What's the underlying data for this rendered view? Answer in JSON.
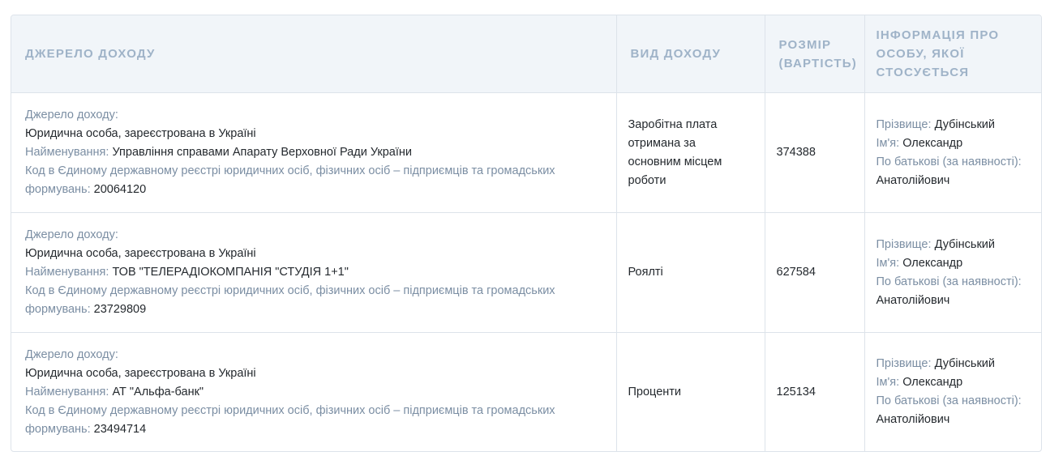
{
  "table": {
    "headers": {
      "source": "Джерело доходу",
      "type": "Вид доходу",
      "amount": "Розмір (вартість)",
      "person": "Інформація про особу, якої стосується"
    },
    "labels": {
      "source": "Джерело доходу:",
      "name": "Найменування:",
      "code": "Код в Єдиному державному реєстрі юридичних осіб, фізичних осіб – підприємців та громадських формувань:",
      "surname": "Прізвище:",
      "firstname": "Ім'я:",
      "patronymic": "По батькові (за наявності):"
    },
    "rows": [
      {
        "source_type": "Юридична особа, зареєстрована в Україні",
        "name": "Управління справами Апарату Верховної Ради України",
        "code": "20064120",
        "income_type": "Заробітна плата отримана за основним місцем роботи",
        "amount": "374388",
        "surname": "Дубінський",
        "firstname": "Олександр",
        "patronymic": "Анатолійович"
      },
      {
        "source_type": "Юридична особа, зареєстрована в Україні",
        "name": "ТОВ \"ТЕЛЕРАДІОКОМПАНІЯ \"СТУДІЯ 1+1\"",
        "code": "23729809",
        "income_type": "Роялті",
        "amount": "627584",
        "surname": "Дубінський",
        "firstname": "Олександр",
        "patronymic": "Анатолійович"
      },
      {
        "source_type": "Юридична особа, зареєстрована в Україні",
        "name": "АТ \"Альфа-банк\"",
        "code": "23494714",
        "income_type": "Проценти",
        "amount": "125134",
        "surname": "Дубінський",
        "firstname": "Олександр",
        "patronymic": "Анатолійович"
      }
    ]
  }
}
